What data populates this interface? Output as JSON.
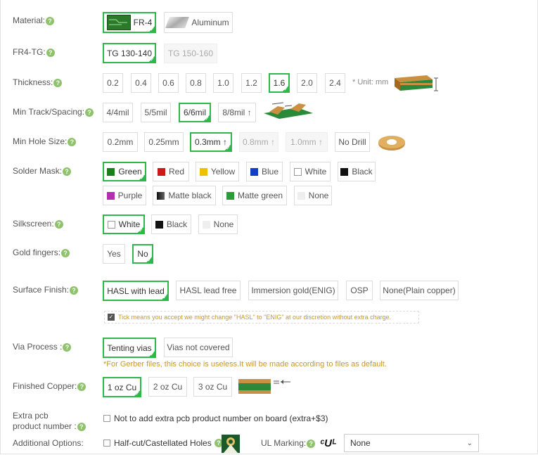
{
  "help_glyph": "?",
  "material": {
    "label": "Material:",
    "options": [
      "FR-4",
      "Aluminum"
    ]
  },
  "tg": {
    "label": "FR4-TG:",
    "options": [
      "TG 130-140",
      "TG 150-160"
    ]
  },
  "thickness": {
    "label": "Thickness:",
    "options": [
      "0.2",
      "0.4",
      "0.6",
      "0.8",
      "1.0",
      "1.2",
      "1.6",
      "2.0",
      "2.4"
    ],
    "unit": "* Unit: mm"
  },
  "track": {
    "label": "Min Track/Spacing:",
    "options": [
      "4/4mil",
      "5/5mil",
      "6/6mil",
      "8/8mil ↑"
    ]
  },
  "hole": {
    "label": "Min Hole Size:",
    "options": [
      "0.2mm",
      "0.25mm",
      "0.3mm ↑",
      "0.8mm ↑",
      "1.0mm ↑",
      "No Drill"
    ]
  },
  "mask": {
    "label": "Solder Mask:",
    "options": [
      {
        "name": "Green",
        "color": "#1a7f1a"
      },
      {
        "name": "Red",
        "color": "#cc1a1a"
      },
      {
        "name": "Yellow",
        "color": "#f0c000"
      },
      {
        "name": "Blue",
        "color": "#1040c0"
      },
      {
        "name": "White",
        "color": "#ffffff"
      },
      {
        "name": "Black",
        "color": "#111111"
      },
      {
        "name": "Purple",
        "color": "#b030b0"
      },
      {
        "name": "Matte black",
        "color": "#333333"
      },
      {
        "name": "Matte green",
        "color": "#2d9b3a"
      },
      {
        "name": "None",
        "color": "#eeeeee"
      }
    ]
  },
  "silk": {
    "label": "Silkscreen:",
    "options": [
      {
        "name": "White",
        "color": "#ffffff"
      },
      {
        "name": "Black",
        "color": "#111111"
      },
      {
        "name": "None",
        "color": "#eeeeee"
      }
    ]
  },
  "gold": {
    "label": "Gold fingers:",
    "options": [
      "Yes",
      "No"
    ]
  },
  "surface": {
    "label": "Surface Finish:",
    "options": [
      "HASL with lead",
      "HASL lead free",
      "Immersion gold(ENIG)",
      "OSP",
      "None(Plain copper)"
    ],
    "tick_note": "Tick means you accept we might change \"HASL\" to \"ENIG\" at our discretion without extra charge."
  },
  "via": {
    "label": "Via Process :",
    "options": [
      "Tenting vias",
      "Vias not covered"
    ],
    "note": "*For Gerber files, this choice is useless.It will be made according to files as default."
  },
  "copper": {
    "label": "Finished Copper:",
    "options": [
      "1 oz Cu",
      "2 oz Cu",
      "3 oz Cu"
    ]
  },
  "extra": {
    "label_line1": "Extra pcb",
    "label_line2": "product number :",
    "checkbox_label": "Not to add extra pcb product number on board (extra+$3)"
  },
  "additional": {
    "label": "Additional Options:",
    "half_cut": "Half-cut/Castellated Holes",
    "ul_label": "UL Marking:",
    "ul_value": "None"
  }
}
